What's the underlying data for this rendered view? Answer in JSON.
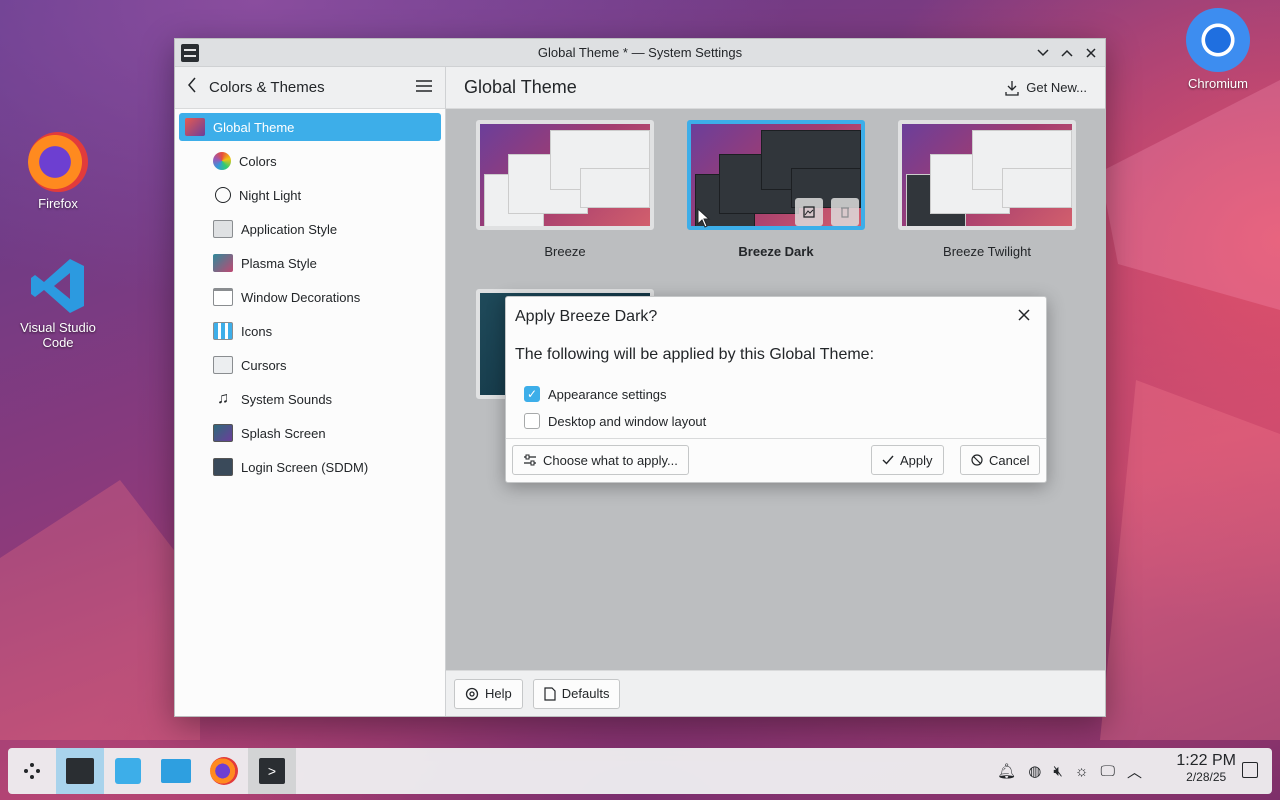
{
  "desktop": {
    "icons": [
      {
        "label": "Firefox"
      },
      {
        "label": "Visual Studio Code"
      },
      {
        "label": "Chromium"
      }
    ]
  },
  "window": {
    "title": "Global Theme * — System Settings",
    "sidebar": {
      "breadcrumb": "Colors & Themes",
      "items": [
        {
          "label": "Global Theme",
          "icon": "global-theme-icon",
          "active": true
        },
        {
          "label": "Colors",
          "icon": "colors-icon"
        },
        {
          "label": "Night Light",
          "icon": "night-light-icon"
        },
        {
          "label": "Application Style",
          "icon": "application-style-icon"
        },
        {
          "label": "Plasma Style",
          "icon": "plasma-style-icon"
        },
        {
          "label": "Window Decorations",
          "icon": "window-decorations-icon"
        },
        {
          "label": "Icons",
          "icon": "icons-icon"
        },
        {
          "label": "Cursors",
          "icon": "cursors-icon"
        },
        {
          "label": "System Sounds",
          "icon": "system-sounds-icon"
        },
        {
          "label": "Splash Screen",
          "icon": "splash-screen-icon"
        },
        {
          "label": "Login Screen (SDDM)",
          "icon": "login-screen-icon"
        }
      ]
    },
    "content": {
      "page_title": "Global Theme",
      "get_new_label": "Get New...",
      "themes": [
        {
          "label": "Breeze"
        },
        {
          "label": "Breeze Dark",
          "selected": true
        },
        {
          "label": "Breeze Twilight"
        }
      ]
    },
    "footer": {
      "help_label": "Help",
      "defaults_label": "Defaults"
    }
  },
  "dialog": {
    "title": "Apply Breeze Dark?",
    "message": "The following will be applied by this Global Theme:",
    "options": [
      {
        "label": "Appearance settings",
        "checked": true
      },
      {
        "label": "Desktop and window layout",
        "checked": false
      }
    ],
    "choose_label": "Choose what to apply...",
    "apply_label": "Apply",
    "cancel_label": "Cancel"
  },
  "taskbar": {
    "time": "1:22 PM",
    "date": "2/28/25"
  },
  "colors": {
    "accent": "#3daee9",
    "window_bg": "#eff0f1"
  }
}
